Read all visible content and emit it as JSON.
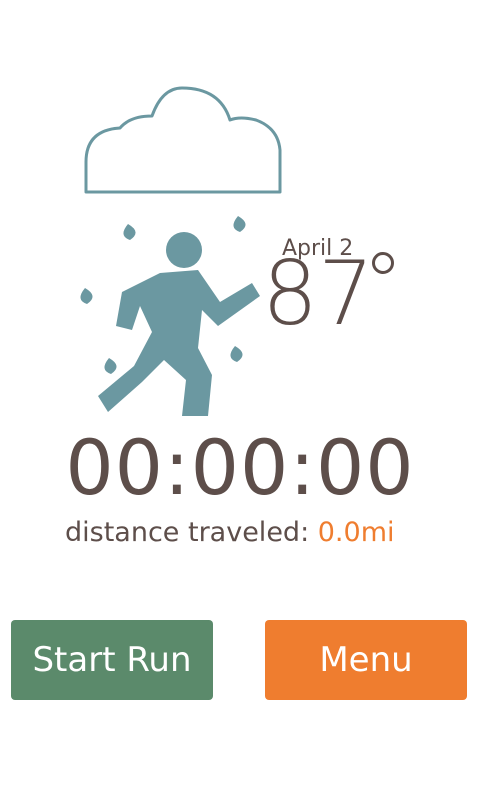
{
  "weather": {
    "date": "April 2",
    "temperature": "87",
    "icon": "rain-cloud-runner-icon"
  },
  "run": {
    "timer": "00:00:00",
    "distance_label": "distance traveled: ",
    "distance_value": "0.0mi"
  },
  "buttons": {
    "start_label": "Start Run",
    "menu_label": "Menu"
  },
  "colors": {
    "text": "#5d4e4a",
    "accent_orange": "#ef7d2f",
    "start_green": "#5b8a6b",
    "icon_teal": "#6b98a1"
  }
}
